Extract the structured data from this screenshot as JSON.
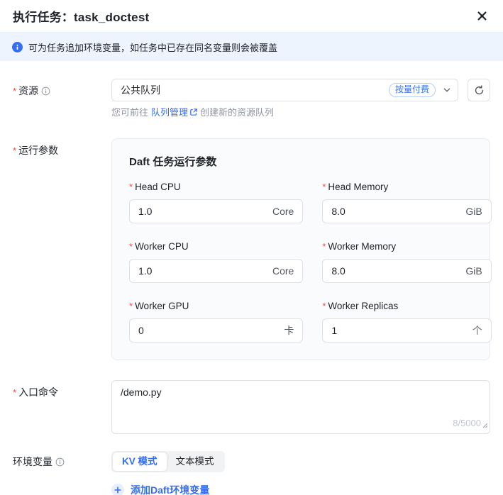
{
  "marks": {
    "required": "*"
  },
  "colors": {
    "accent": "#336df4",
    "required_red": "#f54a45",
    "banner_bg": "#eef4fe"
  },
  "header": {
    "title": "执行任务：task_doctest"
  },
  "banner": {
    "text": "可为任务追加环境变量，如任务中已存在同名变量则会被覆盖"
  },
  "resource": {
    "label": "资源",
    "value": "公共队列",
    "tag": "按量付费",
    "helper_prefix": "您可前往",
    "helper_link": "队列管理",
    "helper_suffix": "创建新的资源队列"
  },
  "run_params": {
    "label": "运行参数",
    "card_title": "Daft 任务运行参数",
    "fields": [
      {
        "label": "Head CPU",
        "value": "1.0",
        "unit": "Core"
      },
      {
        "label": "Head Memory",
        "value": "8.0",
        "unit": "GiB"
      },
      {
        "label": "Worker CPU",
        "value": "1.0",
        "unit": "Core"
      },
      {
        "label": "Worker Memory",
        "value": "8.0",
        "unit": "GiB"
      },
      {
        "label": "Worker GPU",
        "value": "0",
        "unit": "卡"
      },
      {
        "label": "Worker Replicas",
        "value": "1",
        "unit": "个"
      }
    ]
  },
  "entry_command": {
    "label": "入口命令",
    "value": "/demo.py",
    "char_count": "8/5000"
  },
  "env_vars": {
    "label": "环境变量",
    "modes": [
      {
        "label": "KV 模式"
      },
      {
        "label": "文本模式"
      }
    ],
    "add_button": "添加Daft环境变量"
  }
}
